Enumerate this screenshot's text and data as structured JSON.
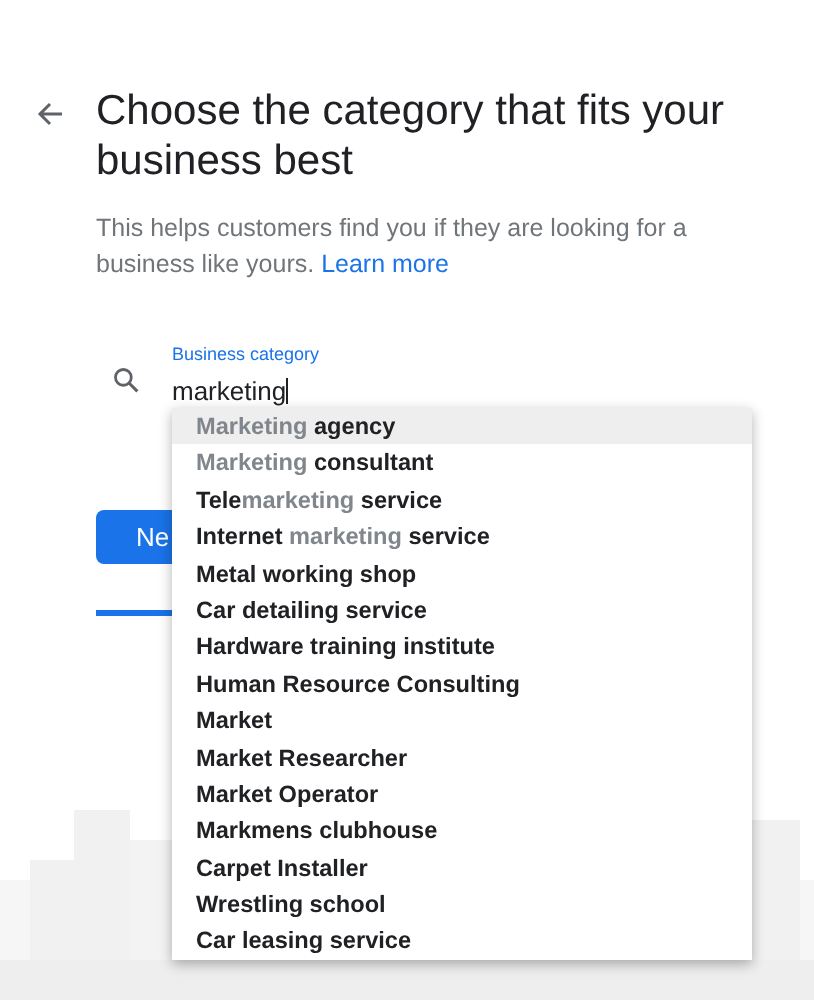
{
  "title": "Choose the category that fits your business best",
  "description": "This helps customers find you if they are looking for a business like yours.",
  "learn_more": "Learn more",
  "field": {
    "label": "Business category",
    "value": "marketing"
  },
  "next_button": "Ne",
  "progress": {
    "level": 0.15
  },
  "suggestions": [
    {
      "selected": true,
      "parts": [
        {
          "text": "Marketing",
          "match": true
        },
        {
          "text": " agency",
          "match": false
        }
      ]
    },
    {
      "selected": false,
      "parts": [
        {
          "text": "Marketing",
          "match": true
        },
        {
          "text": " consultant",
          "match": false
        }
      ]
    },
    {
      "selected": false,
      "parts": [
        {
          "text": "Tele",
          "match": false
        },
        {
          "text": "marketing",
          "match": true
        },
        {
          "text": " service",
          "match": false
        }
      ]
    },
    {
      "selected": false,
      "parts": [
        {
          "text": "Internet ",
          "match": false
        },
        {
          "text": "marketing",
          "match": true
        },
        {
          "text": " service",
          "match": false
        }
      ]
    },
    {
      "selected": false,
      "parts": [
        {
          "text": "Metal working shop",
          "match": false
        }
      ]
    },
    {
      "selected": false,
      "parts": [
        {
          "text": "Car detailing service",
          "match": false
        }
      ]
    },
    {
      "selected": false,
      "parts": [
        {
          "text": "Hardware training institute",
          "match": false
        }
      ]
    },
    {
      "selected": false,
      "parts": [
        {
          "text": "Human Resource Consulting",
          "match": false
        }
      ]
    },
    {
      "selected": false,
      "parts": [
        {
          "text": "Market",
          "match": false
        }
      ]
    },
    {
      "selected": false,
      "parts": [
        {
          "text": "Market Researcher",
          "match": false
        }
      ]
    },
    {
      "selected": false,
      "parts": [
        {
          "text": "Market Operator",
          "match": false
        }
      ]
    },
    {
      "selected": false,
      "parts": [
        {
          "text": "Markmens clubhouse",
          "match": false
        }
      ]
    },
    {
      "selected": false,
      "parts": [
        {
          "text": "Carpet Installer",
          "match": false
        }
      ]
    },
    {
      "selected": false,
      "parts": [
        {
          "text": "Wrestling school",
          "match": false
        }
      ]
    },
    {
      "selected": false,
      "parts": [
        {
          "text": "Car leasing service",
          "match": false
        }
      ]
    }
  ]
}
